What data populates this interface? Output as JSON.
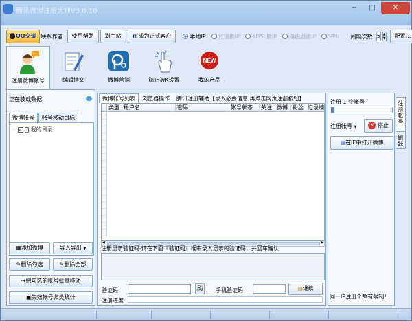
{
  "window": {
    "title": "腾讯微博注册大师V3.0.10",
    "buttons": {
      "minimize": "−",
      "maximize": "□",
      "close": "✕"
    }
  },
  "toolbar": {
    "qq_label": "QQ交谈",
    "contact_label": "联系作者",
    "help_label": "使用帮助",
    "home_label": "到主站",
    "formal_label": "成为正式客户",
    "ip_options": [
      {
        "label": "本地IP",
        "selected": true
      },
      {
        "label": "代理换IP",
        "selected": false
      },
      {
        "label": "ADSL换IP",
        "selected": false
      },
      {
        "label": "路由器换IP",
        "selected": false
      },
      {
        "label": "VPN",
        "selected": false
      }
    ],
    "interval_label": "间隔次数",
    "interval_value": "5",
    "config_label": "配置..."
  },
  "nav": [
    {
      "label": "注册微博帐号",
      "icon": "user-register-icon",
      "selected": true
    },
    {
      "label": "编辑博文",
      "icon": "edit-note-icon",
      "selected": false
    },
    {
      "label": "微博营销",
      "icon": "marketing-icon",
      "selected": false
    },
    {
      "label": "防止被K设置",
      "icon": "hand-click-icon",
      "selected": false
    },
    {
      "label": "我的产品",
      "icon": "new-badge-icon",
      "selected": false
    }
  ],
  "left": {
    "status": "正在装载数据",
    "tabs": [
      "微博帐号",
      "帐号移动目标"
    ],
    "tree_root": "我的目录",
    "buttons": {
      "add": "添加微博",
      "import_export": "导入导出",
      "delete_checked": "删除勾选",
      "delete_all": "删除全部",
      "batch_move": "把勾选的帐号批量移动",
      "fail_stats": "失效帐号归类统计"
    }
  },
  "center": {
    "tabs": [
      "微博帐号列表",
      "浏览器操作",
      "腾讯注册辅助【录入必要信息,再点击网页注册按钮】"
    ],
    "columns": [
      "类型",
      "用户名",
      "密码",
      "帐号状态",
      "关注",
      "微博",
      "粉丝",
      "记录编号"
    ],
    "hint": "注册显示验证码-请在下面『验证码』框中录入显示的验证码，并回车确认",
    "captcha_label": "验证码",
    "refresh_label": "刷",
    "mobile_captcha_label": "手机验证码",
    "continue_label": "继续",
    "progress_label": "注册进度"
  },
  "right": {
    "register_count_label": "注册 1 个帐号",
    "mode_label": "注册帐号",
    "stop_label": "停止",
    "open_ie_label": "在IE中打开微博",
    "footer": "同一IP注册个数有限制！",
    "side_tabs": [
      "注册帐号",
      "跳跃"
    ]
  },
  "colors": {
    "accent": "#2a62b8",
    "stop": "#d93a2f",
    "new_badge": "#cc1f1a",
    "qq": "#f4b93a"
  }
}
